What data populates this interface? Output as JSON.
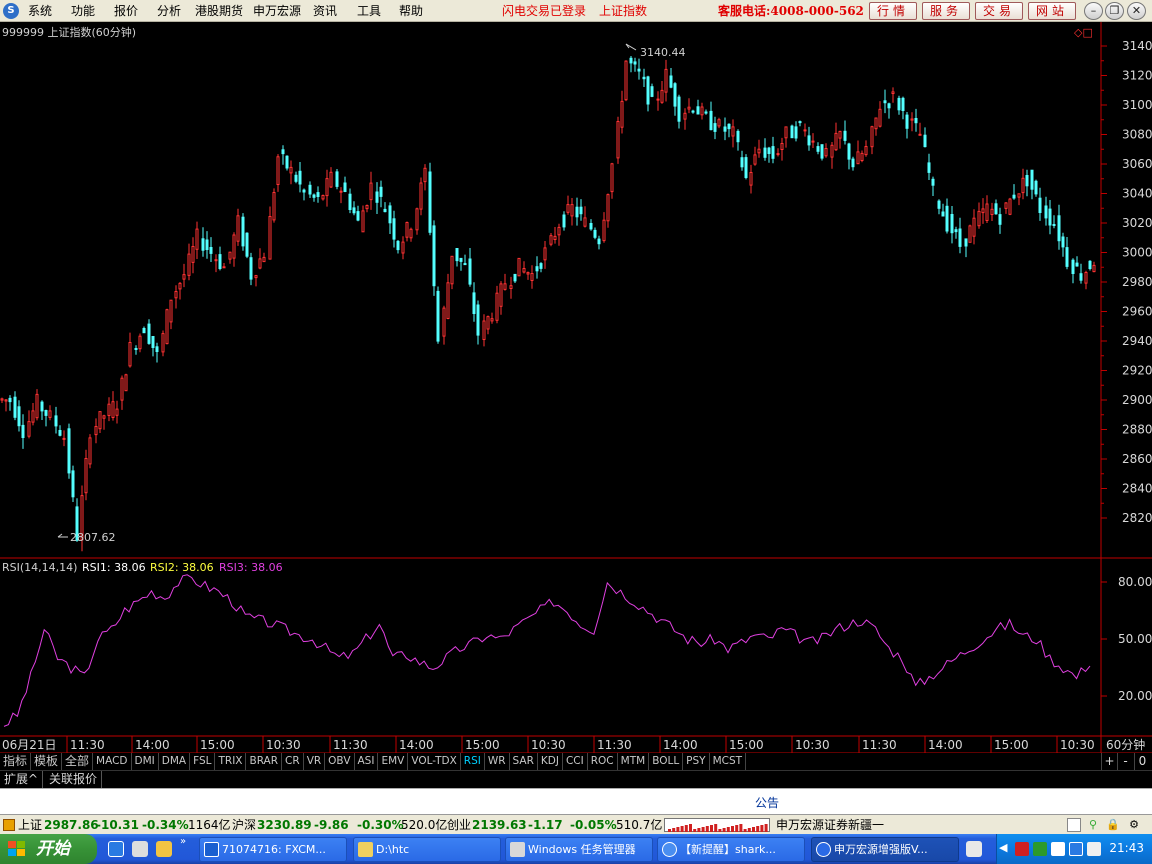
{
  "menu": {
    "items": [
      "系统",
      "功能",
      "报价",
      "分析",
      "港股期货",
      "申万宏源",
      "资讯",
      "工具",
      "帮助"
    ],
    "status_login": "闪电交易已登录",
    "status_index": "上证指数",
    "hotline": "客服电话:4008-000-562",
    "buttons": [
      "行情",
      "服务",
      "交易",
      "网站"
    ]
  },
  "chart": {
    "header": "999999 上证指数(60分钟)",
    "high_label": "3140.44",
    "low_label": "2807.62",
    "price_axis": [
      "3140",
      "3120",
      "3100",
      "3080",
      "3060",
      "3040",
      "3020",
      "3000",
      "2980",
      "2960",
      "2940",
      "2920",
      "2900",
      "2880",
      "2860",
      "2840",
      "2820"
    ],
    "rsi_axis": [
      "80.00",
      "50.00",
      "20.00"
    ],
    "rsi_header": {
      "name": "RSI(14,14,14)",
      "rsi1": "RSI1: 38.06",
      "rsi2": "RSI2: 38.06",
      "rsi3": "RSI3: 38.06"
    },
    "time_labels": [
      "06月21日",
      "11:30",
      "14:00",
      "15:00",
      "10:30",
      "11:30",
      "14:00",
      "15:00",
      "10:30",
      "11:30",
      "14:00",
      "15:00",
      "10:30",
      "11:30",
      "14:00",
      "15:00",
      "10:30"
    ],
    "period_label": "60分钟",
    "colors": {
      "up": "#ff3232",
      "down": "#54ffff",
      "rsi": "#e040e0",
      "axis": "#c00000"
    }
  },
  "chart_data": {
    "type": "candlestick",
    "title": "999999 上证指数(60分钟)",
    "ylim": [
      2807.62,
      3140.44
    ],
    "y_ticks": [
      2820,
      2840,
      2860,
      2880,
      2900,
      2920,
      2940,
      2960,
      2980,
      3000,
      3020,
      3040,
      3060,
      3080,
      3100,
      3120,
      3140
    ],
    "high": 3140.44,
    "low": 2807.62,
    "close_path": [
      2900,
      2880,
      2898,
      2888,
      2875,
      2808,
      2880,
      2890,
      2898,
      2935,
      2950,
      2930,
      2970,
      2985,
      3010,
      3000,
      2990,
      3020,
      2985,
      3000,
      3065,
      3055,
      3040,
      3035,
      3050,
      3040,
      3020,
      3045,
      3030,
      3005,
      3020,
      3055,
      2940,
      3000,
      2990,
      2945,
      2960,
      2980,
      2990,
      2985,
      3000,
      3020,
      3030,
      3020,
      3010,
      3060,
      3130,
      3120,
      3100,
      3120,
      3095,
      3100,
      3090,
      3085,
      3080,
      3050,
      3070,
      3065,
      3080,
      3085,
      3075,
      3065,
      3080,
      3060,
      3070,
      3100,
      3105,
      3090,
      3080,
      3040,
      3020,
      3005,
      3020,
      3030,
      3025,
      3040,
      3050,
      3030,
      3020,
      2995,
      2985,
      2995
    ]
  },
  "rsi_data": {
    "type": "line",
    "name": "RSI(14,14,14)",
    "ylim": [
      0,
      100
    ],
    "y_ticks": [
      20,
      50,
      80
    ],
    "values": [
      5,
      10,
      30,
      55,
      40,
      35,
      30,
      50,
      55,
      65,
      70,
      75,
      72,
      80,
      82,
      78,
      75,
      70,
      62,
      60,
      58,
      55,
      52,
      50,
      45,
      40,
      42,
      50,
      58,
      40,
      42,
      38,
      35,
      40,
      45,
      48,
      52,
      50,
      55,
      60,
      65,
      70,
      65,
      58,
      55,
      80,
      75,
      70,
      65,
      60,
      55,
      50,
      48,
      50,
      45,
      48,
      52,
      50,
      55,
      52,
      48,
      50,
      55,
      58,
      60,
      55,
      45,
      40,
      25,
      30,
      35,
      40,
      45,
      50,
      55,
      58,
      52,
      50,
      40,
      35,
      30,
      38
    ]
  },
  "indicators": [
    "指标",
    "模板",
    "全部",
    "MACD",
    "DMI",
    "DMA",
    "FSL",
    "TRIX",
    "BRAR",
    "CR",
    "VR",
    "OBV",
    "ASI",
    "EMV",
    "VOL-TDX",
    "RSI",
    "WR",
    "SAR",
    "KDJ",
    "CCI",
    "ROC",
    "MTM",
    "BOLL",
    "PSY",
    "MCST"
  ],
  "indicator_right": [
    "+",
    "-",
    "0"
  ],
  "ext_tabs": [
    "扩展^",
    "关联报价"
  ],
  "notice": "公告",
  "statusbar": {
    "sh_label": "上证",
    "sh_value": "2987.86",
    "sh_change": "-10.31",
    "sh_pct": "-0.34%",
    "sh_amount": "1164亿",
    "hs_label": "沪深",
    "hs_value": "3230.89",
    "hs_change": "-9.86",
    "hs_pct": "-0.30%",
    "hs_amount": "520.0亿",
    "cy_label": "创业",
    "cy_value": "2139.63",
    "cy_change": "-1.17",
    "cy_pct": "-0.05%",
    "cy_amount": "510.7亿",
    "ticker": "申万宏源证券新疆一"
  },
  "taskbar": {
    "start": "开始",
    "tasks": [
      "71074716: FXCM...",
      "D:\\htc",
      "Windows 任务管理器",
      "【新提醒】shark...",
      "申万宏源增强版V..."
    ],
    "clock": "21:43"
  }
}
